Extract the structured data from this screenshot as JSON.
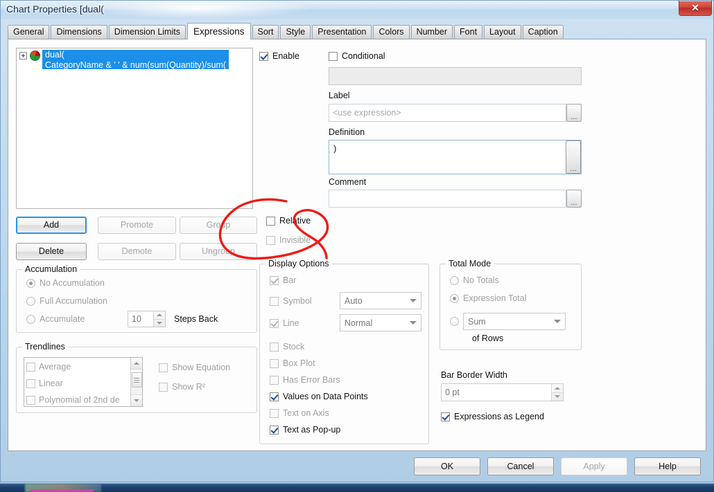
{
  "window": {
    "title": "Chart Properties [dual(",
    "close_label": "✕"
  },
  "tabs": [
    {
      "label": "General",
      "active": false
    },
    {
      "label": "Dimensions",
      "active": false
    },
    {
      "label": "Dimension Limits",
      "active": false
    },
    {
      "label": "Expressions",
      "active": true
    },
    {
      "label": "Sort",
      "active": false
    },
    {
      "label": "Style",
      "active": false
    },
    {
      "label": "Presentation",
      "active": false
    },
    {
      "label": "Colors",
      "active": false
    },
    {
      "label": "Number",
      "active": false
    },
    {
      "label": "Font",
      "active": false
    },
    {
      "label": "Layout",
      "active": false
    },
    {
      "label": "Caption",
      "active": false
    }
  ],
  "expression_list": {
    "icon": "pie-chart-icon",
    "expand_icon": "plus-expand-icon",
    "selected_text": "dual(\nCategoryName & ' ' & num(sum(Quantity)/sum("
  },
  "list_buttons": {
    "add": "Add",
    "promote": "Promote",
    "group": "Group",
    "delete": "Delete",
    "demote": "Demote",
    "ungroup": "Ungroup"
  },
  "expression_options": {
    "enable_label": "Enable",
    "enable_checked": true,
    "conditional_label": "Conditional",
    "conditional_checked": false,
    "conditional_value": "",
    "label_caption": "Label",
    "label_placeholder": "<use expression>",
    "definition_caption": "Definition",
    "definition_value": ")",
    "comment_caption": "Comment",
    "comment_value": "",
    "ellipsis": "...",
    "relative_label": "Relative",
    "relative_checked": false,
    "invisible_label": "Invisible",
    "invisible_checked": false
  },
  "accumulation": {
    "legend": "Accumulation",
    "no_accumulation": "No Accumulation",
    "full_accumulation": "Full Accumulation",
    "accumulate": "Accumulate",
    "selected": "No Accumulation",
    "steps_value": "10",
    "steps_label": "Steps Back"
  },
  "trendlines": {
    "legend": "Trendlines",
    "items": [
      {
        "label": "Average",
        "checked": false
      },
      {
        "label": "Linear",
        "checked": false
      },
      {
        "label": "Polynomial of 2nd de",
        "checked": false
      }
    ],
    "show_equation": "Show Equation",
    "show_equation_checked": false,
    "show_r2": "Show R²",
    "show_r2_checked": false
  },
  "display_options": {
    "legend": "Display Options",
    "items": [
      {
        "label": "Bar",
        "checked": true,
        "enabled": false
      },
      {
        "label": "Symbol",
        "checked": false,
        "enabled": false
      },
      {
        "label": "Line",
        "checked": true,
        "enabled": false
      },
      {
        "label": "Stock",
        "checked": false,
        "enabled": false
      },
      {
        "label": "Box Plot",
        "checked": false,
        "enabled": false
      },
      {
        "label": "Has Error Bars",
        "checked": false,
        "enabled": false
      },
      {
        "label": "Values on Data Points",
        "checked": true,
        "enabled": true
      },
      {
        "label": "Text on Axis",
        "checked": false,
        "enabled": false
      },
      {
        "label": "Text as Pop-up",
        "checked": true,
        "enabled": true
      }
    ],
    "symbol_combo": "Auto",
    "line_combo": "Normal"
  },
  "total_mode": {
    "legend": "Total Mode",
    "no_totals": "No Totals",
    "expression_total": "Expression Total",
    "selected": "Expression Total",
    "aggregation": "Sum",
    "of_rows": "of Rows"
  },
  "bar_border": {
    "caption": "Bar Border Width",
    "value": "0 pt"
  },
  "expressions_legend": {
    "label": "Expressions as Legend",
    "checked": true
  },
  "footer": {
    "ok": "OK",
    "cancel": "Cancel",
    "apply": "Apply",
    "help": "Help",
    "apply_enabled": false
  },
  "annotation": {
    "type": "hand-drawn-red-loop",
    "color": "#ee1c18",
    "targets": [
      "Relative",
      "Invisible"
    ]
  }
}
